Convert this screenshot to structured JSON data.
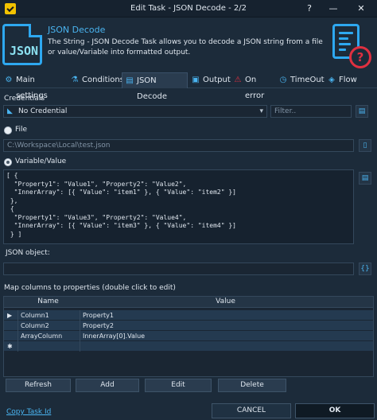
{
  "window": {
    "title": "Edit Task - JSON Decode - 2/2",
    "help_glyph": "?",
    "minimize_glyph": "—",
    "close_glyph": "✕"
  },
  "header": {
    "logo_text": "JSON",
    "title": "JSON Decode",
    "description": "The String - JSON Decode Task allows you to decode a JSON string from a file or value/Variable into formatted output.",
    "help_badge": "?"
  },
  "tabs": [
    {
      "label": "Main settings",
      "icon": "gear-icon",
      "glyph": "⚙"
    },
    {
      "label": "Conditions",
      "icon": "conditions-icon",
      "glyph": "⚗"
    },
    {
      "label": "JSON Decode",
      "icon": "json-file-icon",
      "glyph": "▤",
      "active": true
    },
    {
      "label": "Output",
      "icon": "output-icon",
      "glyph": "▣"
    },
    {
      "label": "On error",
      "icon": "warning-icon",
      "glyph": "⚠"
    },
    {
      "label": "TimeOut",
      "icon": "clock-icon",
      "glyph": "◷"
    },
    {
      "label": "Flow",
      "icon": "flow-icon",
      "glyph": "◈"
    }
  ],
  "credentials": {
    "label": "Credentials",
    "selected": "No Credential",
    "filter_placeholder": "Filter.."
  },
  "file_option": {
    "label": "File",
    "path": "C:\\Workspace\\Local\\test.json"
  },
  "value_option": {
    "label": "Variable/Value",
    "text": "[ {\n  \"Property1\": \"Value1\", \"Property2\": \"Value2\",\n  \"InnerArray\": [{ \"Value\": \"item1\" }, { \"Value\": \"item2\" }]\n },\n {\n  \"Property1\": \"Value3\", \"Property2\": \"Value4\",\n  \"InnerArray\": [{ \"Value\": \"item3\" }, { \"Value\": \"item4\" }]\n } ]"
  },
  "json_object": {
    "label": "JSON object:",
    "value": ""
  },
  "mapping": {
    "label": "Map columns to properties (double click to edit)",
    "columns": [
      "Name",
      "Value"
    ],
    "rows": [
      {
        "name": "Column1",
        "value": "Property1",
        "marker": "▶"
      },
      {
        "name": "Column2",
        "value": "Property2",
        "marker": ""
      },
      {
        "name": "ArrayColumn",
        "value": "InnerArray[0].Value",
        "marker": ""
      }
    ],
    "new_row_marker": "✱"
  },
  "grid_buttons": {
    "refresh": "Refresh",
    "add": "Add",
    "edit": "Edit",
    "delete": "Delete"
  },
  "footer": {
    "copy_link": "Copy Task Id",
    "cancel": "CANCEL",
    "ok": "OK"
  }
}
